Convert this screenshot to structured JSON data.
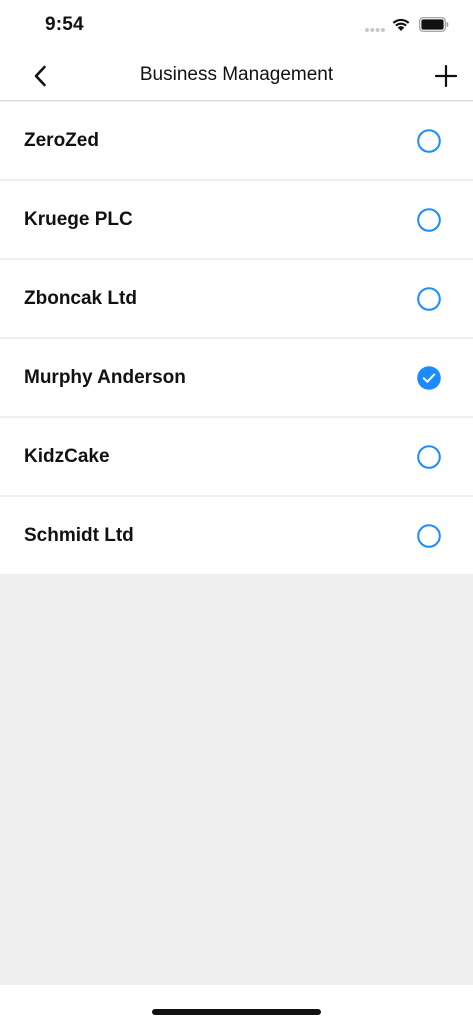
{
  "status_bar": {
    "time": "9:54"
  },
  "nav": {
    "title": "Business Management",
    "back_icon": "chevron-left-icon",
    "add_icon": "plus-icon"
  },
  "businesses": [
    {
      "name": "ZeroZed",
      "selected": false
    },
    {
      "name": "Kruege PLC",
      "selected": false
    },
    {
      "name": "Zboncak Ltd",
      "selected": false
    },
    {
      "name": "Murphy Anderson",
      "selected": true
    },
    {
      "name": "KidzCake",
      "selected": false
    },
    {
      "name": "Schmidt Ltd",
      "selected": false
    }
  ],
  "colors": {
    "accent": "#1a8cff",
    "background": "#efefef",
    "surface": "#ffffff",
    "text": "#111111"
  }
}
